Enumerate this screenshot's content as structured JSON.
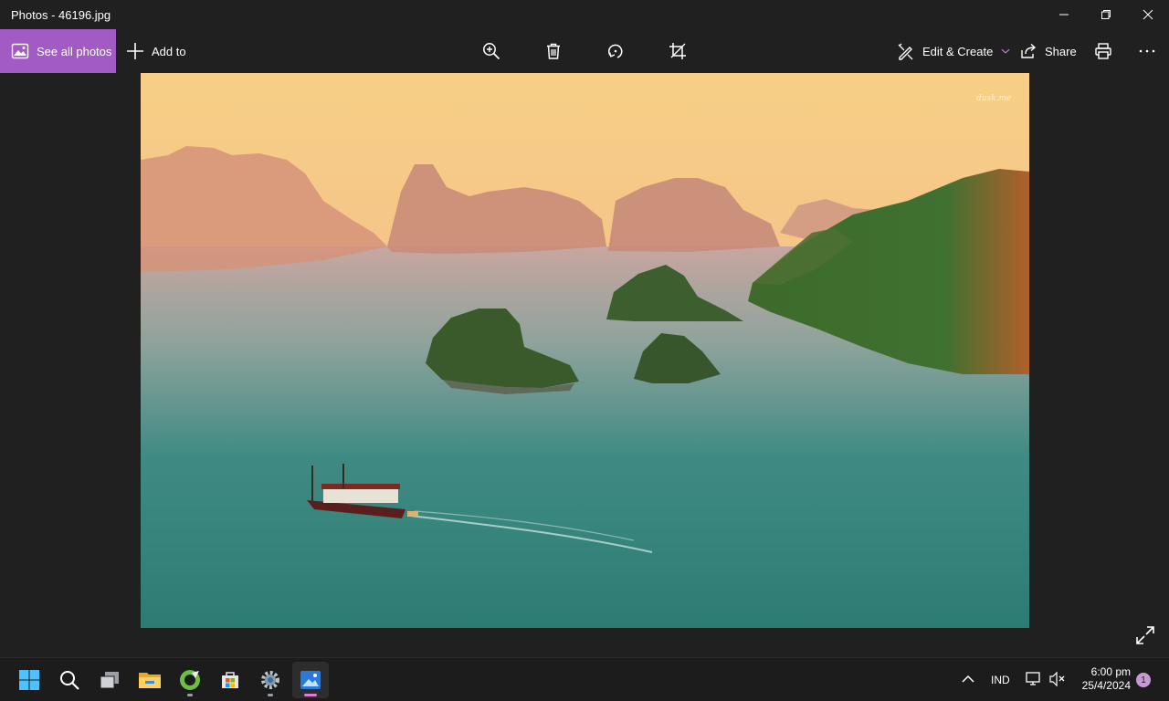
{
  "window": {
    "title": "Photos - 46196.jpg",
    "controls": [
      "minimize",
      "restore",
      "close"
    ]
  },
  "toolbar": {
    "see_all_label": "See all photos",
    "add_to_label": "Add to",
    "edit_create_label": "Edit & Create",
    "share_label": "Share",
    "accent": "#a35bc4"
  },
  "viewer": {
    "photo_name": "46196.jpg",
    "watermark": "dusk.me"
  },
  "taskbar": {
    "apps": [
      "start",
      "search",
      "task-view",
      "file-explorer",
      "coreldraw",
      "microsoft-store",
      "settings",
      "photos"
    ],
    "active_app": "photos",
    "language": "IND",
    "time": "6:00 pm",
    "date": "25/4/2024",
    "notification_count": "1"
  }
}
